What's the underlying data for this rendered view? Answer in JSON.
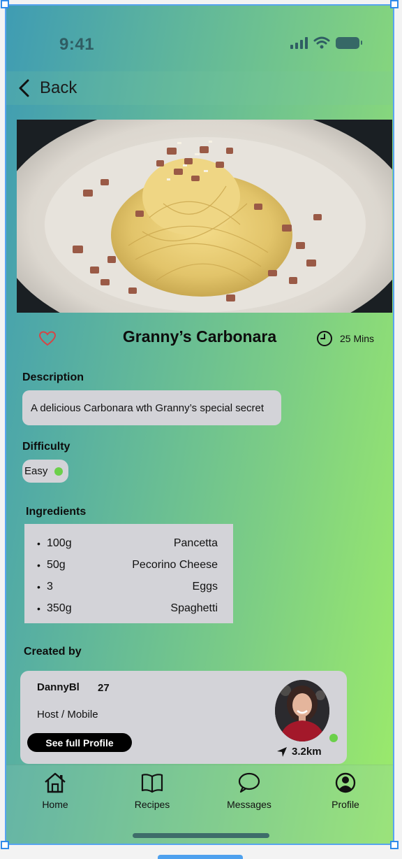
{
  "status_bar": {
    "time": "9:41"
  },
  "nav": {
    "back_label": "Back"
  },
  "recipe": {
    "title": "Granny’s Carbonara",
    "time_label": "25 Mins",
    "description_heading": "Description",
    "description": "A delicious Carbonara wth Granny’s special secret",
    "difficulty_heading": "Difficulty",
    "difficulty": "Easy",
    "ingredients_heading": "Ingredients",
    "ingredients": [
      {
        "qty": "100g",
        "name": "Pancetta"
      },
      {
        "qty": "50g",
        "name": "Pecorino Cheese"
      },
      {
        "qty": "3",
        "name": "Eggs"
      },
      {
        "qty": "350g",
        "name": "Spaghetti"
      }
    ]
  },
  "creator": {
    "heading": "Created by",
    "username": "DannyBl",
    "age": "27",
    "role": "Host / Mobile",
    "profile_button": "See full Profile",
    "distance": "3.2km",
    "online": true
  },
  "tabbar": {
    "items": [
      {
        "label": "Home",
        "icon": "home-icon"
      },
      {
        "label": "Recipes",
        "icon": "book-icon"
      },
      {
        "label": "Messages",
        "icon": "chat-bubble-icon"
      },
      {
        "label": "Profile",
        "icon": "user-circle-icon"
      }
    ]
  },
  "colors": {
    "gradient_start": "#3f9cb3",
    "gradient_end": "#9ceb6a",
    "card_bg": "#d3d3d8",
    "status_green": "#6bd04a",
    "heart_red": "#d64545"
  }
}
